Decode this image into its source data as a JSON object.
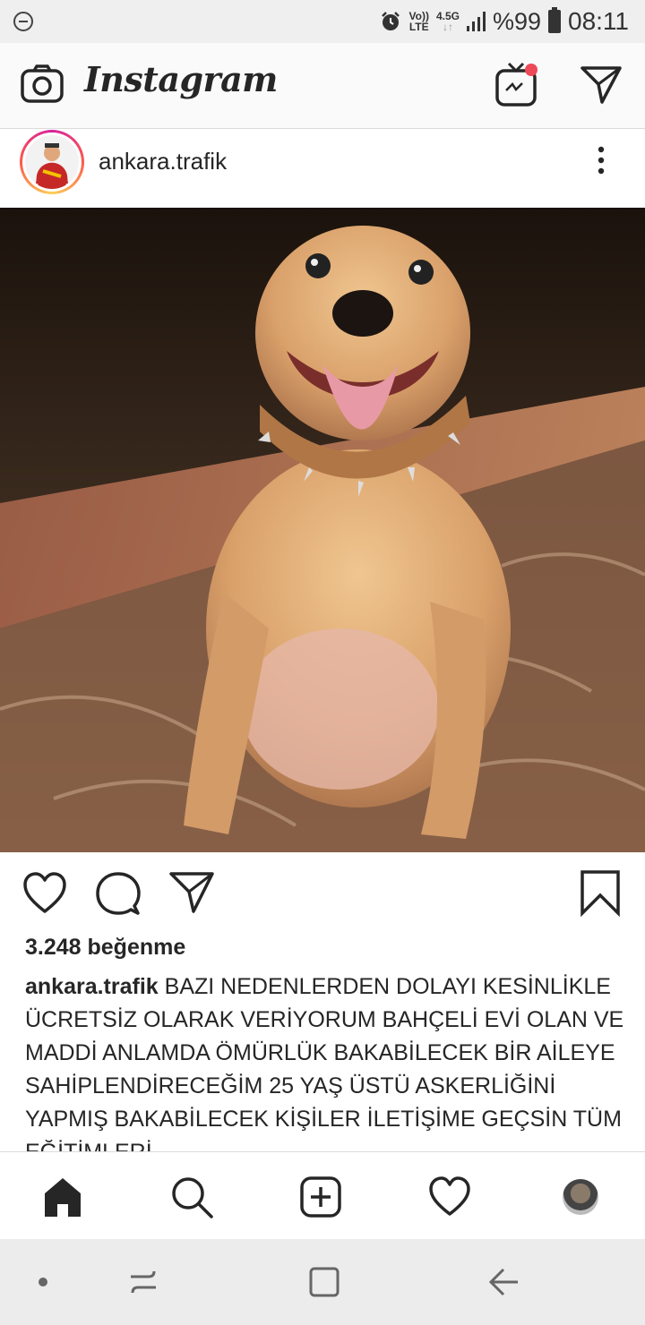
{
  "status_bar": {
    "network_top": "Vo))",
    "network_bottom": "LTE",
    "gen_top": "4.5G",
    "gen_bottom": "↓↑",
    "battery": "%99",
    "time": "08:11"
  },
  "header": {
    "brand": "Instagram",
    "icons": [
      "camera-icon",
      "igtv-icon",
      "direct-message-icon"
    ],
    "notification_color": "#ed4956"
  },
  "post": {
    "username": "ankara.trafik",
    "likes": "3.248 beğenme",
    "caption_user": "ankara.trafik",
    "caption_text": "BAZI NEDENLERDEN DOLAYI KESİNLİKLE ÜCRETSİZ OLARAK VERİYORUM BAHÇELİ EVİ OLAN VE MADDİ ANLAMDA ÖMÜRLÜK BAKABİLECEK BİR AİLEYE SAHİPLENDİRECEĞİM 25 YAŞ ÜSTÜ ASKERLİĞİNİ YAPMIŞ BAKABİLECEK KİŞİLER İLETİŞİME GEÇSİN TÜM EĞİTİMLERİ"
  },
  "bottom_nav": {
    "items": [
      "home-icon",
      "search-icon",
      "add-post-icon",
      "activity-heart-icon",
      "profile-avatar"
    ]
  },
  "android_nav": {
    "items": [
      "dot-icon",
      "recent-apps-icon",
      "home-square-icon",
      "back-arrow-icon"
    ]
  }
}
